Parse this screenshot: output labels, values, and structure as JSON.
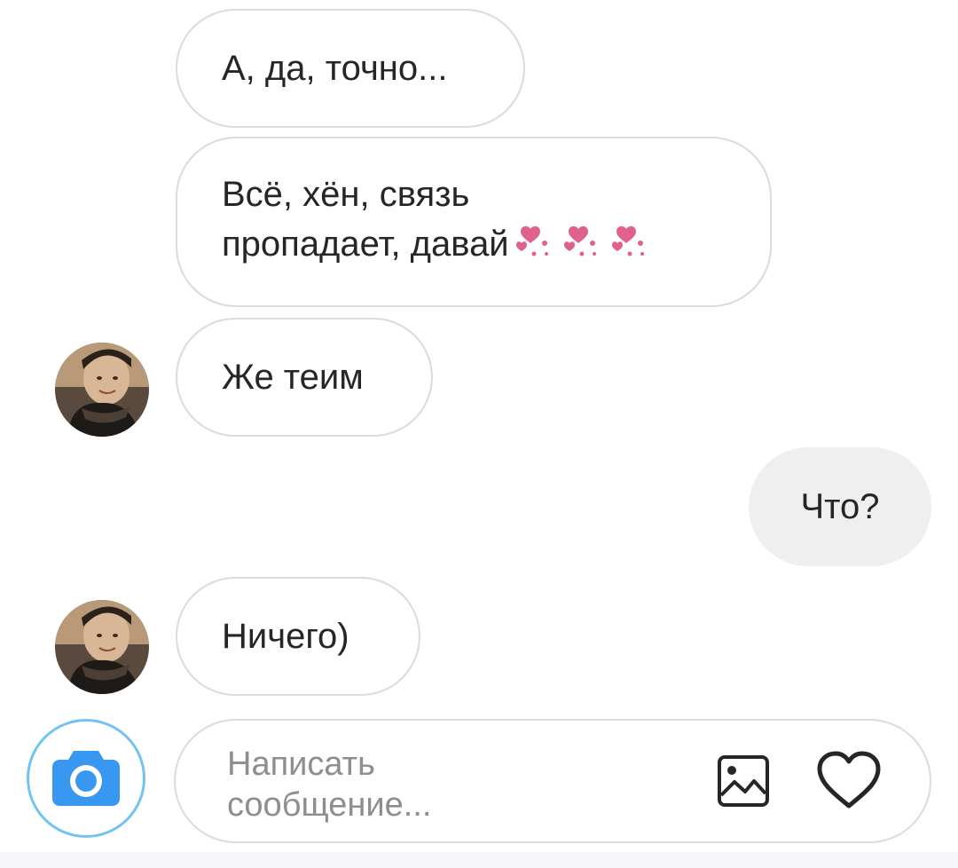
{
  "conversation": {
    "messages": [
      {
        "id": "m1",
        "direction": "incoming",
        "text": "А, да, точно..."
      },
      {
        "id": "m2",
        "direction": "incoming",
        "line1": "Всё, хён, связь",
        "line2": "пропадает, давай",
        "emoji": "sparkling-hearts"
      },
      {
        "id": "m3",
        "direction": "incoming",
        "text": "Же теим",
        "has_avatar": true
      },
      {
        "id": "m4",
        "direction": "outgoing",
        "text": "Что?"
      },
      {
        "id": "m5",
        "direction": "incoming",
        "text": "Ничего)",
        "has_avatar": true
      }
    ]
  },
  "composer": {
    "placeholder": "Написать сообщение...",
    "camera_icon": "camera-icon",
    "gallery_icon": "image-icon",
    "like_icon": "heart-icon"
  },
  "colors": {
    "bubble_border": "#dbdbdb",
    "outgoing_bubble": "#efefef",
    "camera_blue": "#3897f0",
    "camera_ring": "#72c3f2",
    "heart_pink": "#e0618e",
    "text": "#262626",
    "placeholder": "#8e8e8e"
  }
}
